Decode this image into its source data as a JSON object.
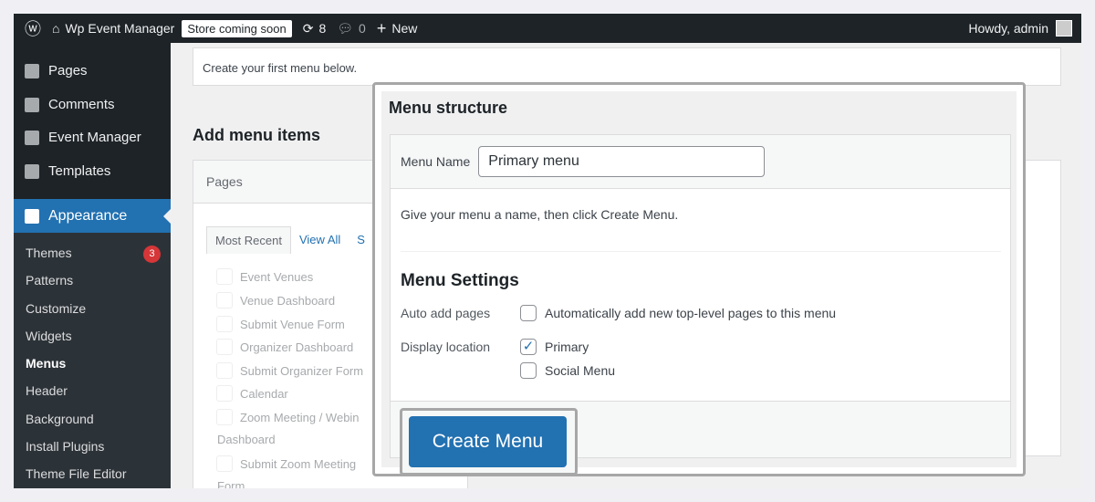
{
  "adminbar": {
    "site": "Wp Event Manager",
    "store": "Store coming soon",
    "updates": "8",
    "comments": "0",
    "new": "New",
    "howdy": "Howdy, admin"
  },
  "sidebar": {
    "items": [
      "Pages",
      "Comments",
      "Event Manager",
      "Templates"
    ],
    "active": "Appearance",
    "sub": [
      "Themes",
      "Patterns",
      "Customize",
      "Widgets",
      "Menus",
      "Header",
      "Background",
      "Install Plugins",
      "Theme File Editor"
    ],
    "themes_badge": "3"
  },
  "notice": "Create your first menu below.",
  "add_items": {
    "heading": "Add menu items",
    "panel": "Pages",
    "tabs": [
      "Most Recent",
      "View All",
      "S"
    ],
    "items": [
      "Event Venues",
      "Venue Dashboard",
      "Submit Venue Form",
      "Organizer Dashboard",
      "Submit Organizer Form",
      "Calendar",
      "Zoom Meeting / Webin"
    ],
    "wrap1": "Dashboard",
    "item8": "Submit Zoom Meeting",
    "wrap2": "Form"
  },
  "structure": {
    "title": "Menu structure",
    "name_label": "Menu Name",
    "name_value": "Primary menu",
    "hint": "Give your menu a name, then click Create Menu.",
    "settings": "Menu Settings",
    "auto_label": "Auto add pages",
    "auto_opt": "Automatically add new top-level pages to this menu",
    "loc_label": "Display location",
    "loc_primary": "Primary",
    "loc_social": "Social Menu",
    "create": "Create Menu"
  }
}
